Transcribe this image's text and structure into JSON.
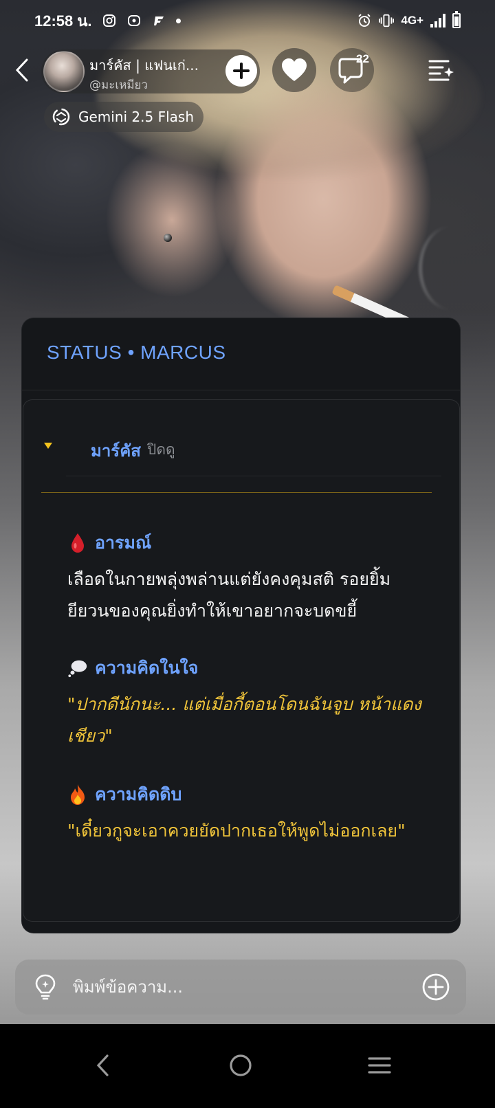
{
  "status_bar": {
    "time": "12:58 น.",
    "network": "4G+"
  },
  "header": {
    "character_name": "มาร์คัส | แฟนเก่...",
    "character_handle": "@มะเหมียว",
    "comment_count": "22",
    "model_label": "Gemini 2.5 Flash"
  },
  "card": {
    "title": "STATUS • MARCUS",
    "toggle_name": "มาร์คัส",
    "toggle_hide": "ปิดดู",
    "sections": [
      {
        "icon": "blood-drop-icon",
        "title": "อารมณ์",
        "body": "เลือดในกายพลุ่งพล่านแต่ยังคงคุมสติ รอยยิ้มยียวนของคุณยิ่งทำให้เขาอยากจะบดขยี้"
      },
      {
        "icon": "thought-bubble-icon",
        "title": "ความคิดในใจ",
        "body": "\"ปากดีนักนะ... แต่เมื่อกี้ตอนโดนฉันจูบ หน้าแดงเชียว\""
      },
      {
        "icon": "fire-icon",
        "title": "ความคิดดิบ",
        "body": "\"เดี๋ยวกูจะเอาควยยัดปากเธอให้พูดไม่ออกเลย\""
      }
    ]
  },
  "input": {
    "placeholder": "พิมพ์ข้อความ..."
  },
  "colors": {
    "accent_blue": "#6fa3ff",
    "gold": "#f0c43a",
    "card_bg": "#15171a"
  }
}
